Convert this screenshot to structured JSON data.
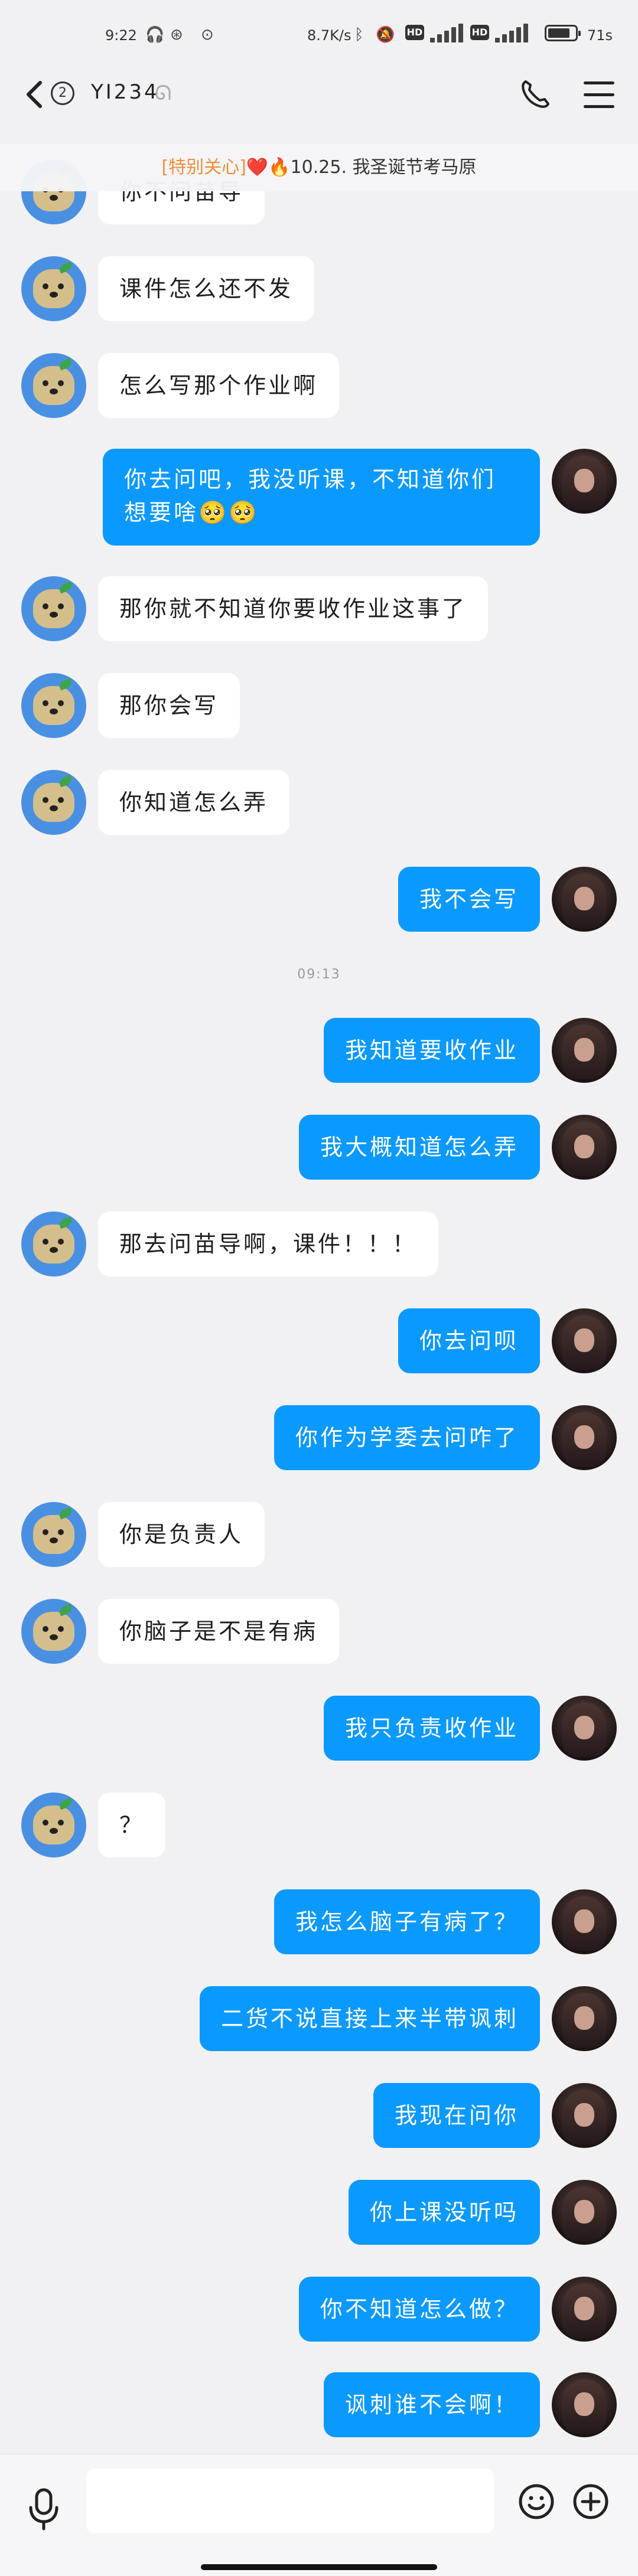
{
  "status_bar": {
    "time": "9:22",
    "network_speed": "8.7K/s",
    "speed_right": "71s",
    "icons": [
      "headphone-icon",
      "app-icon",
      "bluetooth-icon",
      "mute-icon",
      "hd-icon",
      "signal-icon",
      "battery-icon"
    ]
  },
  "header": {
    "unread_count": "2",
    "contact_name": "YI234",
    "icons": [
      "back-icon",
      "ear-icon",
      "phone-icon",
      "menu-icon"
    ]
  },
  "banner": {
    "tag": "[特别关心]",
    "heart": "❤️",
    "fire": "🔥",
    "text": "10.25. 我圣诞节考马原"
  },
  "time_separator": "09:13",
  "messages": [
    {
      "side": "left",
      "text": "你不问苗导"
    },
    {
      "side": "left",
      "text": "课件怎么还不发"
    },
    {
      "side": "left",
      "text": "怎么写那个作业啊"
    },
    {
      "side": "right",
      "text": "你去问吧，我没听课，不知道你们想要啥🥺🥺"
    },
    {
      "side": "left",
      "text": "那你就不知道你要收作业这事了"
    },
    {
      "side": "left",
      "text": "那你会写"
    },
    {
      "side": "left",
      "text": "你知道怎么弄"
    },
    {
      "side": "right",
      "text": "我不会写"
    },
    {
      "side": "right",
      "text": "我知道要收作业"
    },
    {
      "side": "right",
      "text": "我大概知道怎么弄"
    },
    {
      "side": "left",
      "text": "那去问苗导啊，课件！！！"
    },
    {
      "side": "right",
      "text": "你去问呗"
    },
    {
      "side": "right",
      "text": "你作为学委去问咋了"
    },
    {
      "side": "left",
      "text": "你是负责人"
    },
    {
      "side": "left",
      "text": "你脑子是不是有病"
    },
    {
      "side": "right",
      "text": "我只负责收作业"
    },
    {
      "side": "left",
      "text": "？"
    },
    {
      "side": "right",
      "text": "我怎么脑子有病了？"
    },
    {
      "side": "right",
      "text": "二货不说直接上来半带讽刺"
    },
    {
      "side": "right",
      "text": "我现在问你"
    },
    {
      "side": "right",
      "text": "你上课没听吗"
    },
    {
      "side": "right",
      "text": "你不知道怎么做？"
    },
    {
      "side": "right",
      "text": "讽刺谁不会啊！"
    }
  ],
  "input": {
    "placeholder": "",
    "value": ""
  },
  "colors": {
    "sent_bubble": "#0a99ff",
    "received_bubble": "#ffffff",
    "background": "#f1f1f3",
    "banner_tag": "#f0903d"
  }
}
